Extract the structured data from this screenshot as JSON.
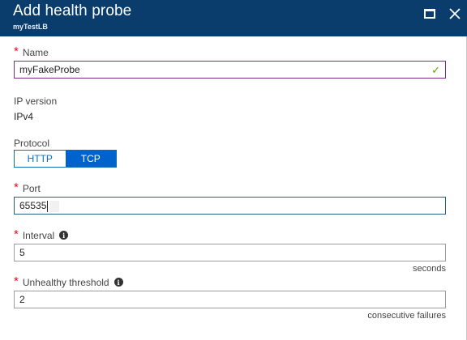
{
  "blade": {
    "title": "Add health probe",
    "subtitle": "myTestLB"
  },
  "form": {
    "name": {
      "label": "Name",
      "value": "myFakeProbe",
      "required": true,
      "valid": true
    },
    "ip_version": {
      "label": "IP version",
      "value": "IPv4"
    },
    "protocol": {
      "label": "Protocol",
      "options": [
        "HTTP",
        "TCP"
      ],
      "selected": "TCP"
    },
    "port": {
      "label": "Port",
      "value": "65535",
      "required": true
    },
    "interval": {
      "label": "Interval",
      "value": "5",
      "unit": "seconds",
      "required": true
    },
    "unhealthy_threshold": {
      "label": "Unhealthy threshold",
      "value": "2",
      "unit": "consecutive failures",
      "required": true
    }
  },
  "icons": {
    "required_marker": "*",
    "info": "i",
    "check": "✓",
    "close": "✕"
  },
  "colors": {
    "header_bg": "#0a3d6b",
    "selected_segment": "#0062cc",
    "valid_check": "#57a300",
    "required": "#e00b1c"
  }
}
